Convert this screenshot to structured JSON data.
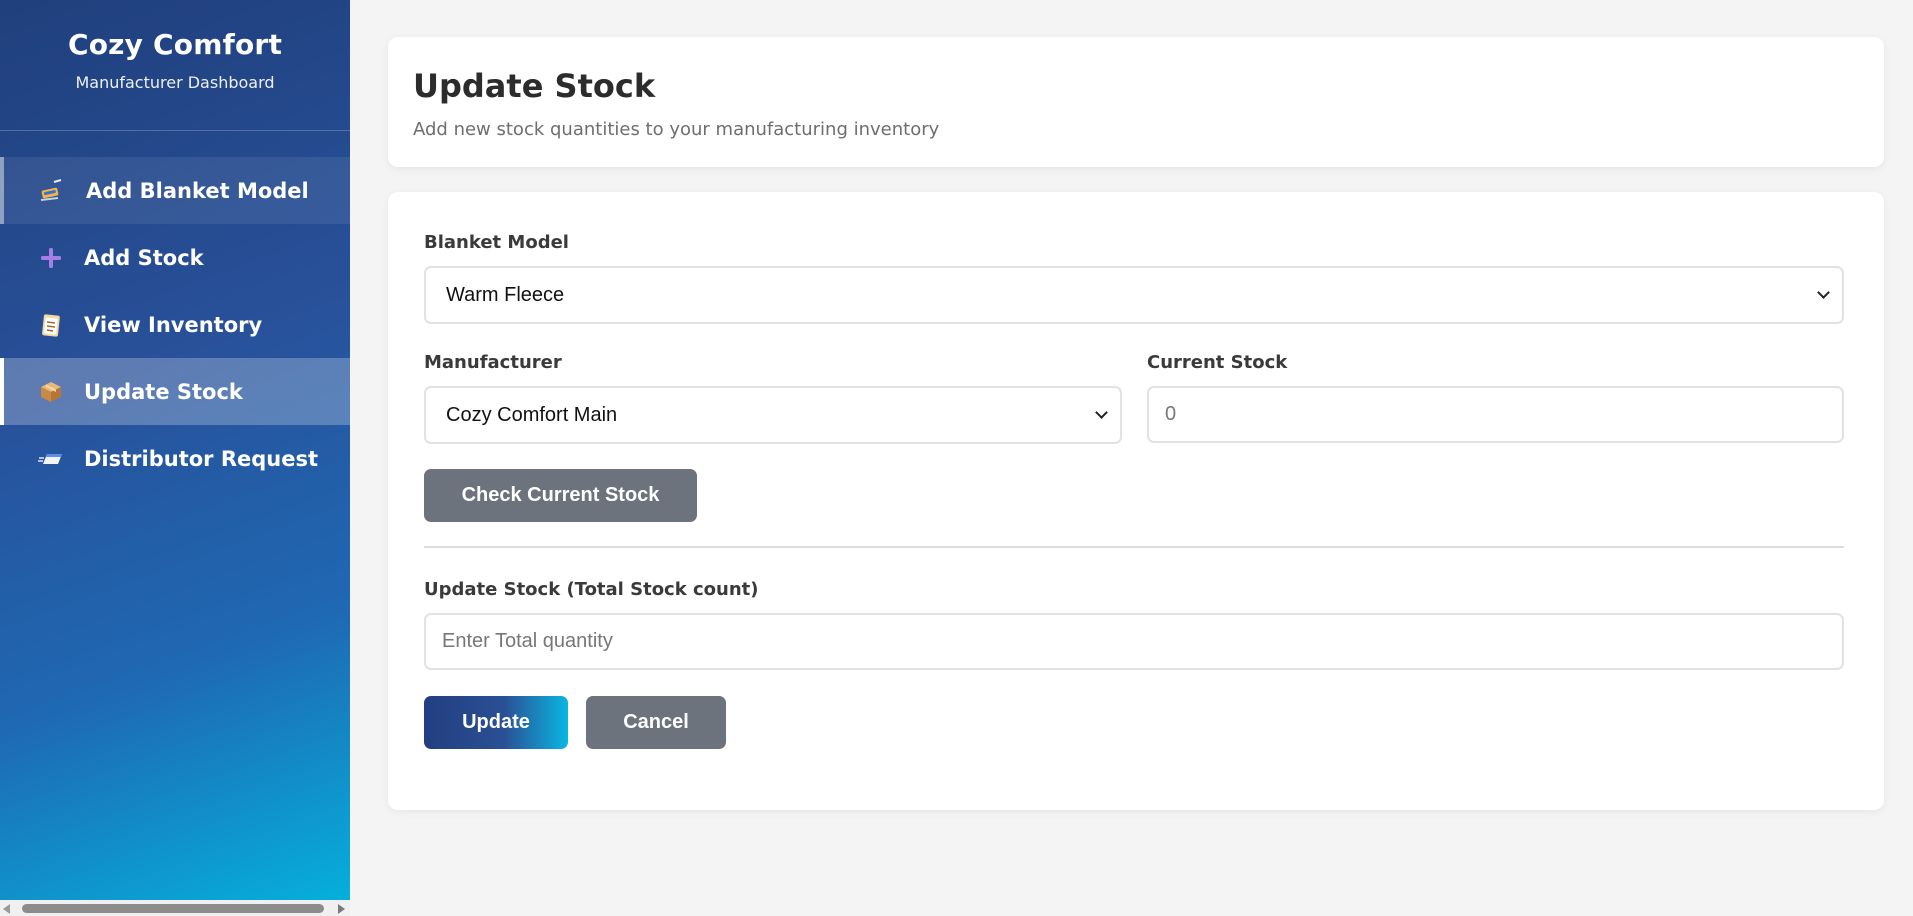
{
  "brand": {
    "title": "Cozy Comfort",
    "subtitle": "Manufacturer Dashboard"
  },
  "sidebar": {
    "items": [
      {
        "label": "Add Blanket Model",
        "icon": "sewing-icon",
        "state": "hover"
      },
      {
        "label": "Add Stock",
        "icon": "plus-icon",
        "state": ""
      },
      {
        "label": "View Inventory",
        "icon": "clipboard-icon",
        "state": ""
      },
      {
        "label": "Update Stock",
        "icon": "package-icon",
        "state": "active"
      },
      {
        "label": "Distributor Request",
        "icon": "fast-delivery-icon",
        "state": ""
      }
    ]
  },
  "header": {
    "title": "Update Stock",
    "subtitle": "Add new stock quantities to your manufacturing inventory"
  },
  "form": {
    "model_label": "Blanket Model",
    "model_value": "Warm Fleece",
    "manufacturer_label": "Manufacturer",
    "manufacturer_value": "Cozy Comfort Main",
    "current_stock_label": "Current Stock",
    "current_stock_placeholder": "0",
    "check_button": "Check Current Stock",
    "update_label": "Update Stock (Total Stock count)",
    "update_placeholder": "Enter Total quantity",
    "update_button": "Update",
    "cancel_button": "Cancel"
  },
  "colors": {
    "sidebar_top": "#203f7c",
    "sidebar_bottom": "#04b3de",
    "gray_button": "#6c737d",
    "page_bg": "#f4f4f4"
  }
}
